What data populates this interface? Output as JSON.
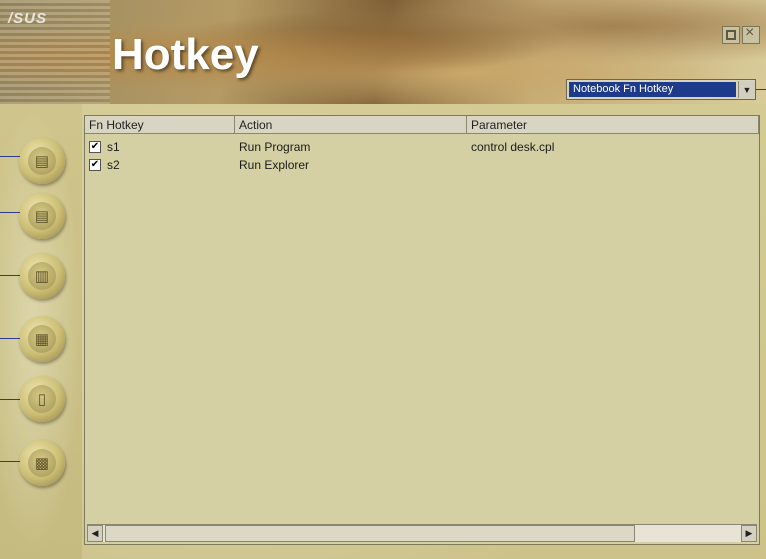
{
  "window": {
    "logo": "/SUS",
    "title": "Hotkey"
  },
  "mode_select": {
    "value": "Notebook Fn Hotkey"
  },
  "table": {
    "columns": [
      "Fn Hotkey",
      "Action",
      "Parameter"
    ],
    "rows": [
      {
        "checked": true,
        "hotkey": "s1",
        "action": "Run Program",
        "parameter": "control desk.cpl"
      },
      {
        "checked": true,
        "hotkey": "s2",
        "action": "Run Explorer",
        "parameter": ""
      }
    ]
  },
  "side_buttons": [
    "add-hotkey-icon",
    "edit-hotkey-icon",
    "copy-hotkey-icon",
    "settings-icon",
    "device-icon",
    "display-icon"
  ],
  "colors": {
    "accent": "#1e3a8a",
    "panel_bg": "#d4d0a4"
  }
}
